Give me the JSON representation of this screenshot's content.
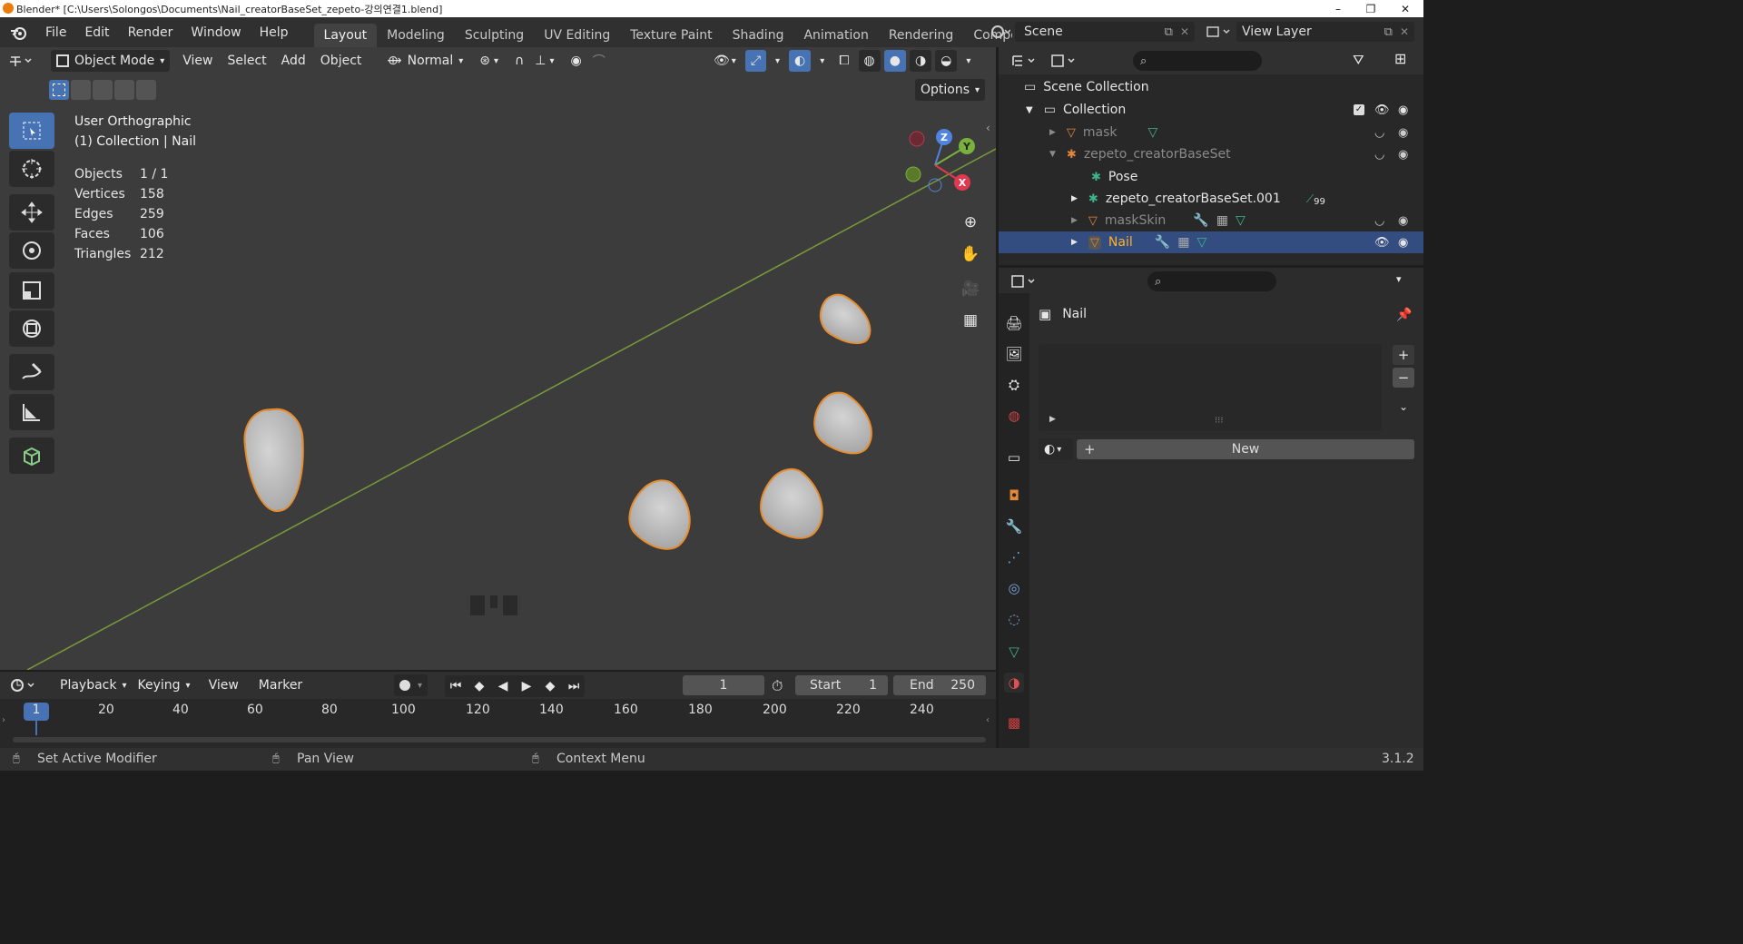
{
  "window": {
    "title": "Blender* [C:\\Users\\Solongos\\Documents\\Nail_creatorBaseSet_zepeto-강의연결1.blend]",
    "minimize": "–",
    "maximize": "❐",
    "close": "✕"
  },
  "menu": {
    "file": "File",
    "edit": "Edit",
    "render": "Render",
    "window": "Window",
    "help": "Help"
  },
  "workspaces": [
    {
      "label": "Layout",
      "active": true
    },
    {
      "label": "Modeling",
      "active": false
    },
    {
      "label": "Sculpting",
      "active": false
    },
    {
      "label": "UV Editing",
      "active": false
    },
    {
      "label": "Texture Paint",
      "active": false
    },
    {
      "label": "Shading",
      "active": false
    },
    {
      "label": "Animation",
      "active": false
    },
    {
      "label": "Rendering",
      "active": false
    },
    {
      "label": "Compo",
      "active": false
    }
  ],
  "scene": {
    "name": "Scene",
    "view_layer": "View Layer"
  },
  "viewport_header": {
    "mode": "Object Mode",
    "view": "View",
    "select": "Select",
    "add": "Add",
    "object": "Object",
    "orientation": "Normal",
    "options": "Options"
  },
  "overlay_text": {
    "view_name": "User Orthographic",
    "collection": "(1) Collection | Nail"
  },
  "stats": [
    {
      "label": "Objects",
      "value": "1 / 1"
    },
    {
      "label": "Vertices",
      "value": "158"
    },
    {
      "label": "Edges",
      "value": "259"
    },
    {
      "label": "Faces",
      "value": "106"
    },
    {
      "label": "Triangles",
      "value": "212"
    }
  ],
  "gizmo": {
    "x": "X",
    "y": "Y",
    "z": "Z"
  },
  "outliner": {
    "scene_collection": "Scene Collection",
    "items": [
      {
        "label": "Collection"
      },
      {
        "label": "mask"
      },
      {
        "label": "zepeto_creatorBaseSet"
      },
      {
        "label": "Pose"
      },
      {
        "label": "zepeto_creatorBaseSet.001",
        "badge": "99"
      },
      {
        "label": "maskSkin"
      },
      {
        "label": "Nail",
        "selected": true
      }
    ]
  },
  "properties": {
    "object_name": "Nail",
    "new_button": "New"
  },
  "timeline": {
    "playback": "Playback",
    "keying": "Keying",
    "view": "View",
    "marker": "Marker",
    "current_frame": "1",
    "start_label": "Start",
    "start": "1",
    "end_label": "End",
    "end": "250",
    "ruler": [
      "20",
      "40",
      "60",
      "80",
      "100",
      "120",
      "140",
      "160",
      "180",
      "200",
      "220",
      "240"
    ],
    "playhead": "1"
  },
  "statusbar": {
    "left": "Set Active Modifier",
    "mid": "Pan View",
    "right": "Context Menu",
    "version": "3.1.2"
  },
  "colors": {
    "accent": "#4772b3",
    "selection_outline": "#e88c2c",
    "header": "#303030"
  }
}
